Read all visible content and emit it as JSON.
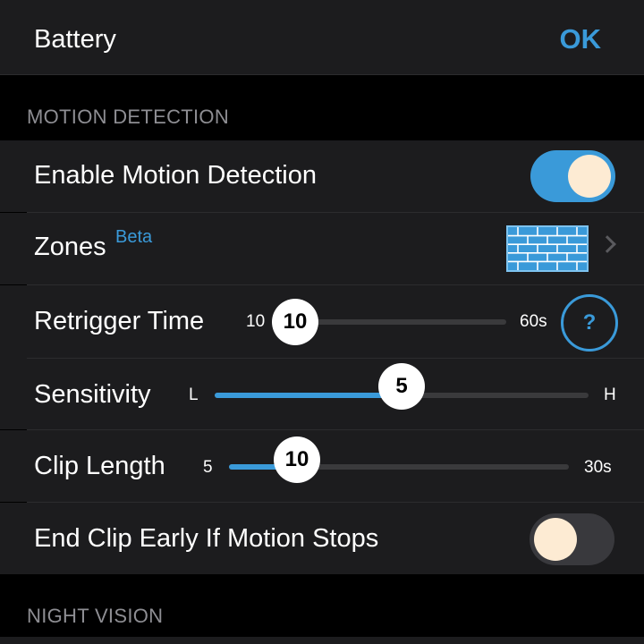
{
  "header": {
    "title": "Battery",
    "ok_label": "OK"
  },
  "sections": {
    "motion_detection": "MOTION DETECTION",
    "night_vision": "NIGHT VISION"
  },
  "motion": {
    "enable_label": "Enable Motion Detection",
    "enable_on": true,
    "zones_label": "Zones",
    "zones_badge": "Beta",
    "zones_icon": "zone-grid-icon",
    "retrigger": {
      "label": "Retrigger Time",
      "min_label": "10",
      "max_label": "60s",
      "value_label": "10",
      "value": 10,
      "min": 10,
      "max": 60,
      "help": "?"
    },
    "sensitivity": {
      "label": "Sensitivity",
      "min_label": "L",
      "max_label": "H",
      "value_label": "5",
      "value": 5,
      "min": 1,
      "max": 9
    },
    "clip_length": {
      "label": "Clip Length",
      "min_label": "5",
      "max_label": "30s",
      "value_label": "10",
      "value": 10,
      "min": 5,
      "max": 30
    },
    "end_early_label": "End Clip Early If Motion Stops",
    "end_early_on": false
  },
  "colors": {
    "accent": "#3a9ad9",
    "row_bg": "#1c1c1e",
    "toggle_knob": "#fdebd3"
  }
}
